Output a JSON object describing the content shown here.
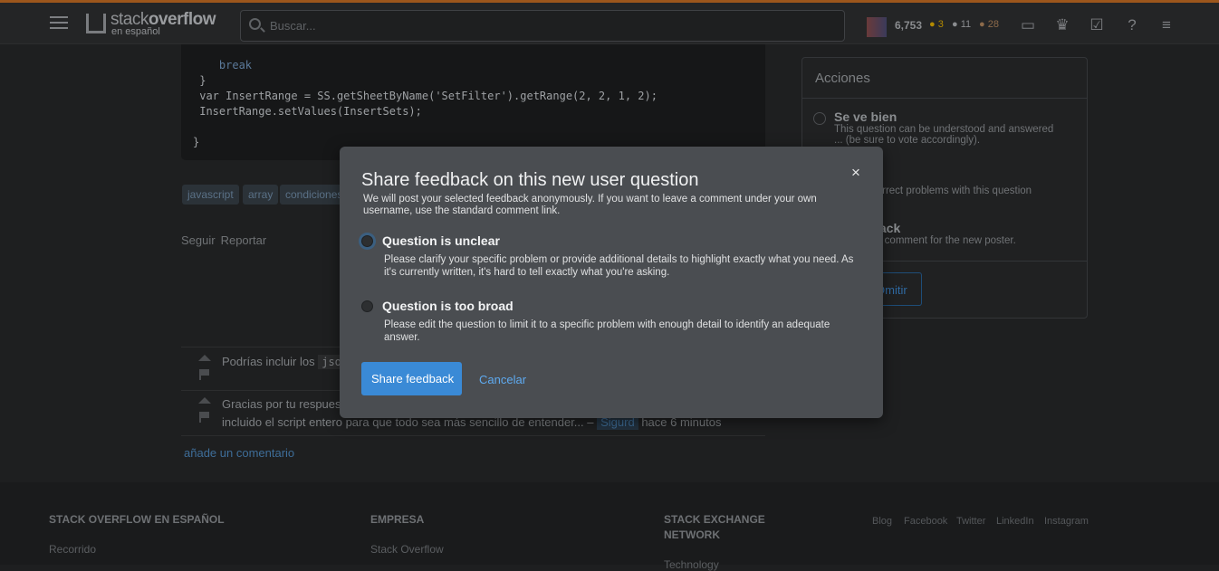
{
  "header": {
    "logo_line1_a": "stack",
    "logo_line1_b": "overflow",
    "logo_line2": "en español",
    "search_placeholder": "Buscar...",
    "reputation": "6,753",
    "badges": {
      "gold": "3",
      "silver": "11",
      "bronze": "28"
    },
    "colors": {
      "gold": "#b38a00",
      "silver": "#8a8c8f",
      "bronze": "#8c6a4a",
      "accent": "#9c561c"
    },
    "icons": [
      "inbox-icon",
      "trophy-icon",
      "review-icon",
      "help-icon",
      "site-switcher-icon"
    ]
  },
  "code": {
    "lines": [
      "  break",
      "}",
      "var InsertRange = SS.getSheetByName('SetFilter').getRange(2, 2, 1, 2);",
      "InsertRange.setValues(InsertSets);",
      "",
      "}"
    ]
  },
  "tags": [
    "javascript",
    "array",
    "condiciones"
  ],
  "post_menu": {
    "follow": "Seguir",
    "report": "Reportar"
  },
  "comments": [
    {
      "text": "Podrías incluir los ",
      "code": "jso"
    },
    {
      "text": "Gracias por tu respuest",
      "text2": "incluido el script entero para que todo sea más sencillo de entender... –",
      "user": "Sigurd",
      "time": "hace 6 minutos"
    }
  ],
  "add_comment": "añade un comentario",
  "sidebar": {
    "title": "Acciones",
    "options": [
      {
        "label": "Se ve bien",
        "desc1": "This question can be understood and answered",
        "desc2": "... (be sure to vote accordingly)."
      },
      {
        "desc": "nd correct problems with this question"
      },
      {
        "label": "edback",
        "desc": "elpful comment for the new poster."
      }
    ],
    "skip": "Omitir"
  },
  "footer": {
    "col1": {
      "title": "STACK OVERFLOW EN ESPAÑOL",
      "link": "Recorrido"
    },
    "col2": {
      "title": "EMPRESA",
      "link": "Stack Overflow"
    },
    "col3": {
      "title1": "STACK EXCHANGE",
      "title2": "NETWORK",
      "link": "Technology"
    },
    "social": [
      "Blog",
      "Facebook",
      "Twitter",
      "LinkedIn",
      "Instagram"
    ]
  },
  "modal": {
    "title": "Share feedback on this new user question",
    "subtitle": "We will post your selected feedback anonymously. If you want to leave a comment under your own username, use the standard comment link.",
    "options": [
      {
        "label": "Question is unclear",
        "desc": "Please clarify your specific problem or provide additional details to highlight exactly what you need. As it's currently written, it's hard to tell exactly what you're asking.",
        "selected": true
      },
      {
        "label": "Question is too broad",
        "desc": "Please edit the question to limit it to a specific problem with enough detail to identify an adequate answer.",
        "selected": false
      }
    ],
    "submit": "Share feedback",
    "cancel": "Cancelar",
    "close": "×"
  }
}
